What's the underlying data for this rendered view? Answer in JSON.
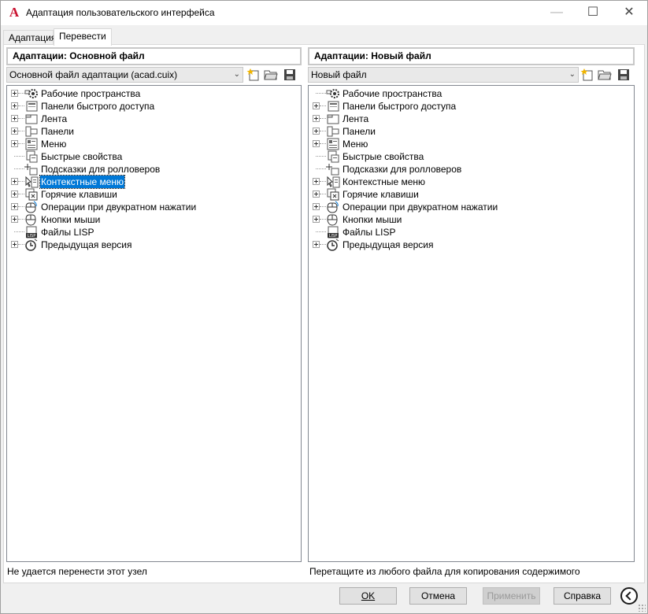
{
  "window": {
    "title": "Адаптация пользовательского интерфейса",
    "app_icon_letter": "A",
    "minimize_glyph": "—",
    "maximize_glyph": "☐",
    "close_glyph": "✕"
  },
  "tabs": [
    {
      "label": "Адаптация",
      "active": false
    },
    {
      "label": "Перевести",
      "active": true
    }
  ],
  "left_panel": {
    "header": "Адаптации: Основной файл",
    "combo_value": "Основной файл адаптации (acad.cuix)",
    "status": "Не удается перенести этот узел",
    "tree": [
      {
        "label": "Рабочие пространства",
        "icon": "gear-workspace-icon",
        "expandable": true
      },
      {
        "label": "Панели быстрого доступа",
        "icon": "quick-access-toolbar-icon",
        "expandable": true
      },
      {
        "label": "Лента",
        "icon": "ribbon-icon",
        "expandable": true
      },
      {
        "label": "Панели",
        "icon": "toolbar-icon",
        "expandable": true
      },
      {
        "label": "Меню",
        "icon": "menu-icon",
        "expandable": true
      },
      {
        "label": "Быстрые свойства",
        "icon": "quick-properties-icon",
        "expandable": false
      },
      {
        "label": "Подсказки для ролловеров",
        "icon": "rollover-tooltip-icon",
        "expandable": false
      },
      {
        "label": "Контекстные меню",
        "icon": "context-menu-icon",
        "expandable": true,
        "selected": true
      },
      {
        "label": "Горячие клавиши",
        "icon": "keyboard-shortcut-icon",
        "expandable": true
      },
      {
        "label": "Операции при двукратном нажатии",
        "icon": "double-click-icon",
        "expandable": true
      },
      {
        "label": "Кнопки мыши",
        "icon": "mouse-buttons-icon",
        "expandable": true
      },
      {
        "label": "Файлы LISP",
        "icon": "lisp-file-icon",
        "expandable": false
      },
      {
        "label": "Предыдущая версия",
        "icon": "legacy-clock-icon",
        "expandable": true
      }
    ]
  },
  "right_panel": {
    "header": "Адаптации: Новый файл",
    "combo_value": "Новый файл",
    "status": "Перетащите из любого файла для копирования содержимого",
    "tree": [
      {
        "label": "Рабочие пространства",
        "icon": "gear-workspace-icon",
        "expandable": false
      },
      {
        "label": "Панели быстрого доступа",
        "icon": "quick-access-toolbar-icon",
        "expandable": true
      },
      {
        "label": "Лента",
        "icon": "ribbon-icon",
        "expandable": true
      },
      {
        "label": "Панели",
        "icon": "toolbar-icon",
        "expandable": true
      },
      {
        "label": "Меню",
        "icon": "menu-icon",
        "expandable": true
      },
      {
        "label": "Быстрые свойства",
        "icon": "quick-properties-icon",
        "expandable": false
      },
      {
        "label": "Подсказки для ролловеров",
        "icon": "rollover-tooltip-icon",
        "expandable": false
      },
      {
        "label": "Контекстные меню",
        "icon": "context-menu-icon",
        "expandable": true
      },
      {
        "label": "Горячие клавиши",
        "icon": "keyboard-shortcut-icon",
        "expandable": true
      },
      {
        "label": "Операции при двукратном нажатии",
        "icon": "double-click-icon",
        "expandable": true
      },
      {
        "label": "Кнопки мыши",
        "icon": "mouse-buttons-icon",
        "expandable": true
      },
      {
        "label": "Файлы LISP",
        "icon": "lisp-file-icon",
        "expandable": false
      },
      {
        "label": "Предыдущая версия",
        "icon": "legacy-clock-icon",
        "expandable": true
      }
    ]
  },
  "buttons": {
    "ok": "OK",
    "cancel": "Отмена",
    "apply": "Применить",
    "help": "Справка"
  },
  "colors": {
    "selection": "#0078d7",
    "app_icon": "#c8102e",
    "new_file_star": "#f0b400",
    "folder": "#e6c66a"
  }
}
